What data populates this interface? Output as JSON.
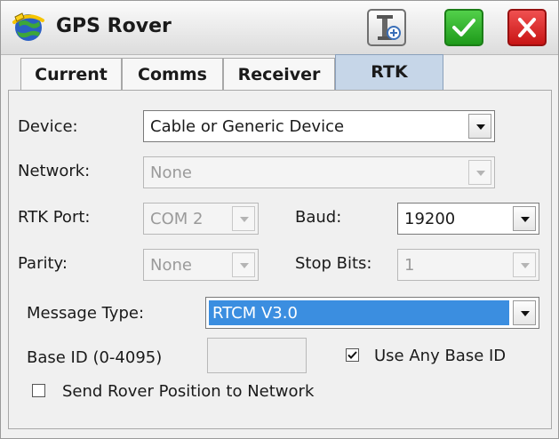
{
  "window": {
    "title": "GPS Rover",
    "icons": {
      "app": "gps-satellite-globe-icon",
      "tools": "receiver-settings-icon",
      "ok": "checkmark-icon",
      "cancel": "close-x-icon"
    },
    "colors": {
      "ok_button": "#2db52a",
      "cancel_button": "#e02020",
      "active_tab": "#c6d6e8",
      "selection": "#3b8ee0"
    }
  },
  "tabs": [
    {
      "label": "Current",
      "active": false
    },
    {
      "label": "Comms",
      "active": false
    },
    {
      "label": "Receiver",
      "active": false
    },
    {
      "label": "RTK",
      "active": true
    }
  ],
  "form": {
    "device": {
      "label": "Device:",
      "value": "Cable or Generic Device",
      "enabled": true
    },
    "network": {
      "label": "Network:",
      "value": "None",
      "enabled": false
    },
    "rtk_port": {
      "label": "RTK Port:",
      "value": "COM 2",
      "enabled": false
    },
    "baud": {
      "label": "Baud:",
      "value": "19200",
      "enabled": true
    },
    "parity": {
      "label": "Parity:",
      "value": "None",
      "enabled": false
    },
    "stop_bits": {
      "label": "Stop Bits:",
      "value": "1",
      "enabled": false
    },
    "message_type": {
      "label": "Message Type:",
      "value": "RTCM V3.0",
      "enabled": true,
      "highlighted": true
    },
    "base_id": {
      "label": "Base ID (0-4095)",
      "value": "",
      "enabled": false
    },
    "use_any_base_id": {
      "label": "Use Any Base ID",
      "checked": true
    },
    "send_rover_position": {
      "label": "Send Rover Position to Network",
      "checked": false
    }
  }
}
